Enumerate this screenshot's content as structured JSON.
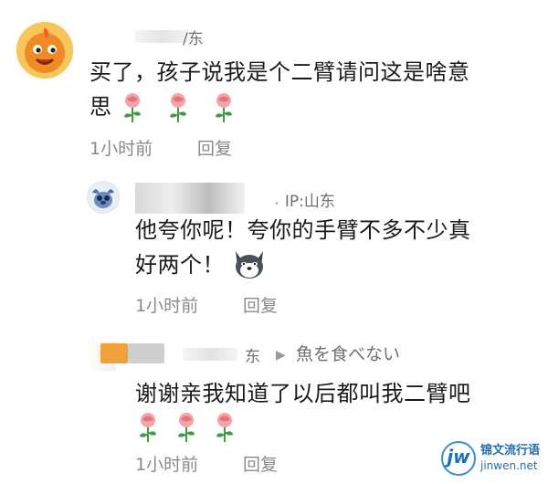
{
  "comments": [
    {
      "author_suffix": "/东",
      "text_line1": "买了，孩子说我是个二臂请问这是啥意",
      "text_line2": "思",
      "reactions": [
        "rose-emoji",
        "rose-emoji",
        "rose-emoji"
      ],
      "time": "1小时前",
      "reply_label": "回复"
    },
    {
      "ip_label": "IP:山东",
      "text_line1": "他夸你呢！夸你的手臂不多不少真",
      "text_line2": "好两个！",
      "emoji": "dog-face-emoji",
      "time": "1小时前",
      "reply_label": "回复"
    },
    {
      "author_suffix": "东",
      "reply_to": "魚を食べない",
      "text_line1": "谢谢亲我知道了以后都叫我二臂吧",
      "reactions": [
        "rose-emoji",
        "rose-emoji",
        "rose-emoji"
      ],
      "time": "1小时前",
      "reply_label": "回复"
    }
  ],
  "watermark": {
    "logo_text": "jw",
    "site_name": "锦文流行语",
    "url": "jinwen.net",
    "brand_color": "#1f6fb2"
  }
}
